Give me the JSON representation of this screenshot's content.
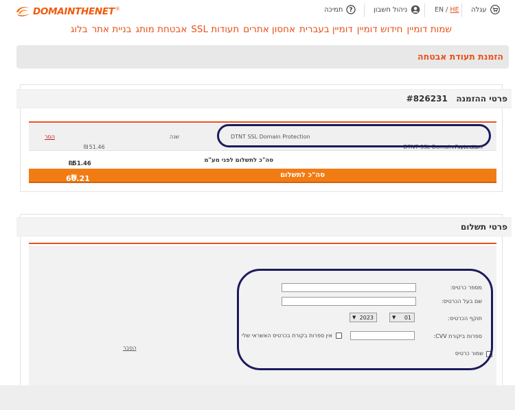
{
  "brand": {
    "logo_prefix": "DOMAIN",
    "logo_suffix": "THENET",
    "logo_reg": "®"
  },
  "topbar": {
    "cart_label": "עגלה",
    "lang_en": "EN",
    "lang_sep": " / ",
    "lang_he": "HE",
    "account_label": "ניהול חשבון",
    "support_label": "תמיכה"
  },
  "nav": {
    "items": [
      "שמות דומיין",
      "חידוש דומיין",
      "דומיין בעברית",
      "אחסון אתרים",
      "תעודות SSL",
      "אבטחת מותג",
      "בניית אתר",
      "בלוג"
    ]
  },
  "page": {
    "title": "הזמנת תעודת אבטחה"
  },
  "order": {
    "heading": "פרטי ההזמנה",
    "order_number": "#826231",
    "item": {
      "type": "רישום תעודת",
      "product": "DTNT SSL Domain Protection",
      "product_name": "DTNT SSL Domain Protection",
      "period": "שנה",
      "price": "51.46",
      "currency": "₪",
      "remove_label": "הסר"
    },
    "subtotal_label": "סה\"כ לתשלום לפני מע\"מ",
    "subtotal_value": "51.46",
    "subtotal_currency": "₪",
    "total_label": "סה\"כ לתשלום",
    "total_value": "60.21",
    "total_currency": "₪"
  },
  "payment": {
    "heading": "פרטי תשלום",
    "card_number_label": "מספר כרטיס:",
    "card_number_value": "",
    "card_holder_label": "שם בעל הכרטיס:",
    "card_holder_value": "",
    "expiry_label": "תוקף הכרטיס:",
    "expiry_month": "01",
    "expiry_year": "2023",
    "cvv_label": "ספרות ביקורת CVV:",
    "cvv_value": "",
    "no_cvv_label": "אין ספרות בקורת בכרטיס האשראי שלי",
    "save_card_label": "שמור כרטיס",
    "help_label": "הסבר"
  },
  "colors": {
    "accent": "#e8501a",
    "orange_bar": "#f27c14",
    "annotation": "#1c1a5c"
  }
}
